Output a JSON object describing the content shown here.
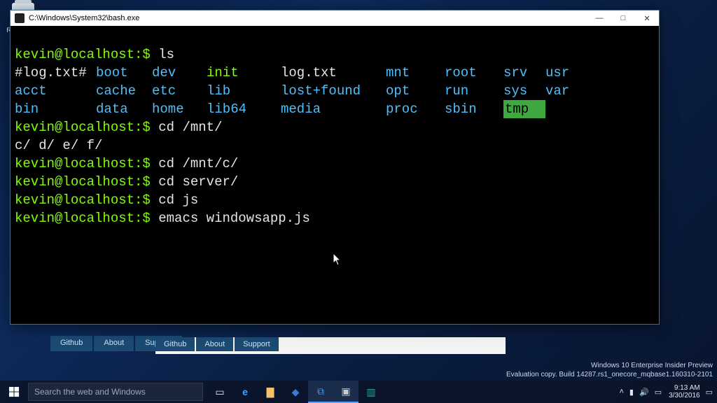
{
  "desktop": {
    "recycle_label": "Recycle Bin"
  },
  "window": {
    "title": "C:\\Windows\\System32\\bash.exe",
    "min": "—",
    "max": "□",
    "close": "✕"
  },
  "term": {
    "prompt": "kevin@localhost:$",
    "cmds": {
      "ls": "ls",
      "cd_mnt": "cd /mnt/",
      "mnt_list": "c/ d/ e/ f/",
      "cd_c": "cd /mnt/c/",
      "cd_server": "cd server/",
      "cd_js": "cd js",
      "emacs": "emacs windowsapp.js"
    },
    "ls": {
      "r1": [
        "#log.txt#",
        "boot",
        "dev",
        "init",
        "log.txt",
        "mnt",
        "root",
        "srv",
        "usr"
      ],
      "r2": [
        "acct",
        "cache",
        "etc",
        "lib",
        "lost+found",
        "opt",
        "run",
        "sys",
        "var"
      ],
      "r3": [
        "bin",
        "data",
        "home",
        "lib64",
        "media",
        "proc",
        "sbin",
        "tmp",
        ""
      ]
    }
  },
  "bgtabs": {
    "a": "Github",
    "b": "About",
    "c": "Support"
  },
  "watermark": {
    "l1": "Windows 10 Enterprise Insider Preview",
    "l2": "Evaluation copy. Build 14287.rs1_onecore_mqbase1.160310-2101"
  },
  "taskbar": {
    "search_placeholder": "Search the web and Windows",
    "time": "9:13 AM",
    "date": "3/30/2016"
  }
}
